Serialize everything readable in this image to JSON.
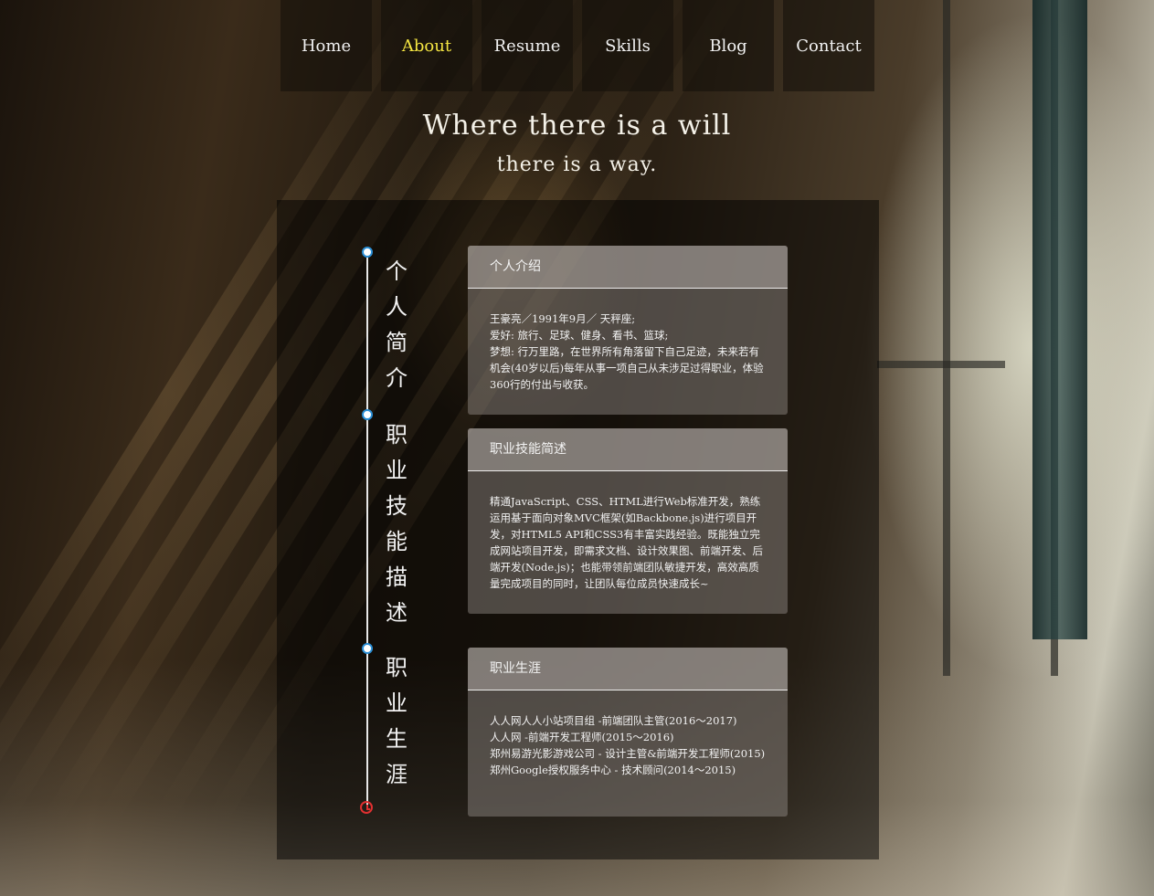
{
  "nav": {
    "items": [
      {
        "label": "Home"
      },
      {
        "label": "About",
        "active": true
      },
      {
        "label": "Resume"
      },
      {
        "label": "Skills"
      },
      {
        "label": "Blog"
      },
      {
        "label": "Contact"
      }
    ]
  },
  "hero": {
    "line1": "Where there is a will",
    "line2": "there is a way."
  },
  "timeline": {
    "labels": [
      "个人简介",
      "职业技能描述",
      "职业生涯"
    ]
  },
  "cards": {
    "intro": {
      "title": "个人介绍",
      "lines": [
        "王豪亮／1991年9月／ 天秤座;",
        "爱好: 旅行、足球、健身、看书、篮球;",
        "梦想: 行万里路，在世界所有角落留下自己足迹，未来若有机会(40岁以后)每年从事一项自己从未涉足过得职业，体验360行的付出与收获。"
      ]
    },
    "skills": {
      "title": "职业技能简述",
      "text": "精通JavaScript、CSS、HTML进行Web标准开发，熟练运用基于面向对象MVC框架(如Backbone.js)进行项目开发，对HTML5 API和CSS3有丰富实践经验。既能独立完成网站项目开发，即需求文档、设计效果图、前端开发、后端开发(Node.js)；也能带领前端团队敏捷开发，高效高质量完成项目的同时，让团队每位成员快速成长~"
    },
    "career": {
      "title": "职业生涯",
      "lines": [
        "人人网人人小站项目组 -前端团队主管(2016～2017)",
        "人人网 -前端开发工程师(2015～2016)",
        "郑州易游光影游戏公司 - 设计主管&前端开发工程师(2015)",
        "郑州Google授权服务中心 - 技术顾问(2014～2015)"
      ]
    }
  },
  "colors": {
    "active_nav": "#f5e642",
    "timeline_dot_border": "#2b8fd6",
    "timeline_end_icon": "#e03030"
  },
  "icons": {
    "timeline_end": "clock-icon"
  }
}
